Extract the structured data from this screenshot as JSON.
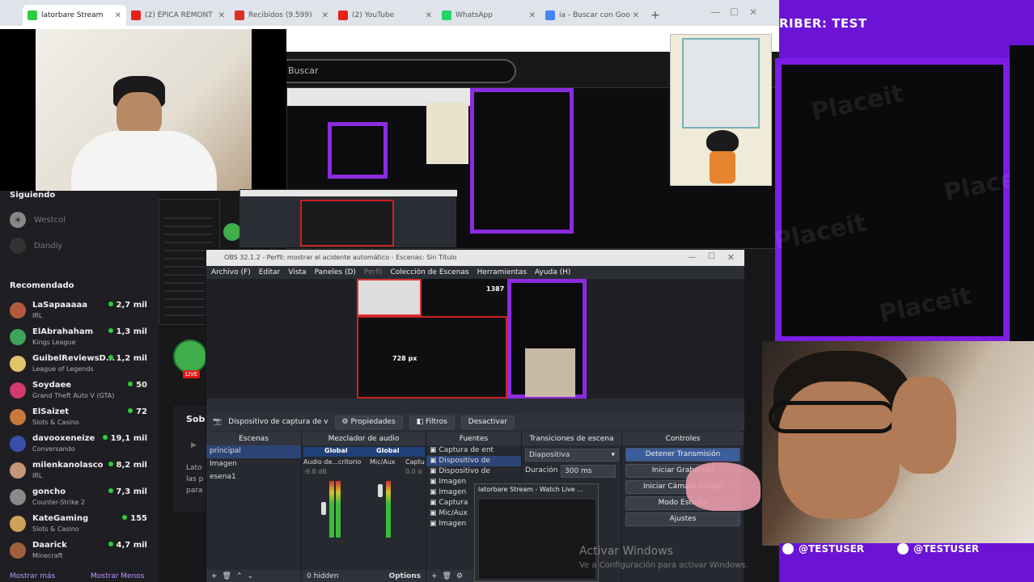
{
  "browser": {
    "tabs": [
      {
        "label": "latorbare Stream",
        "active": true,
        "color": "#2ecc40"
      },
      {
        "label": "(2) ÉPICA REMONT",
        "active": false,
        "color": "#e62117"
      },
      {
        "label": "Recibidos (9.599)",
        "active": false,
        "color": "#d93025"
      },
      {
        "label": "(2) YouTube",
        "active": false,
        "color": "#e62117"
      },
      {
        "label": "WhatsApp",
        "active": false,
        "color": "#25d366"
      },
      {
        "label": "ia - Buscar con Goo",
        "active": false,
        "color": "#4285f4"
      }
    ],
    "new_tab": "+"
  },
  "twitch": {
    "search_placeholder": "Buscar",
    "following_header": "Siguiendo",
    "following": [
      "Westcol",
      "Dandiy"
    ],
    "recommended_header": "Recomendado",
    "recommended": [
      {
        "name": "LaSapaaaaa",
        "game": "IRL",
        "viewers": "2,7 mil",
        "color": "#b45a3c"
      },
      {
        "name": "ElAbrahaham",
        "game": "Kings League",
        "viewers": "1,3 mil",
        "color": "#3fa35c"
      },
      {
        "name": "GuibelReviewsD...",
        "game": "League of Legends",
        "viewers": "1,2 mil",
        "color": "#e0c46a"
      },
      {
        "name": "Soydaee",
        "game": "Grand Theft Auto V (GTA)",
        "viewers": "50",
        "color": "#d23b6e"
      },
      {
        "name": "ElSaizet",
        "game": "Slots & Casino",
        "viewers": "72",
        "color": "#c87a3a"
      },
      {
        "name": "davooxeneize",
        "game": "Conversando",
        "viewers": "19,1 mil",
        "color": "#3a4fa8"
      },
      {
        "name": "milenkanolasco",
        "game": "IRL",
        "viewers": "8,2 mil",
        "color": "#c8957a"
      },
      {
        "name": "goncho",
        "game": "Counter-Strike 2",
        "viewers": "7,3 mil",
        "color": "#8a8a8a"
      },
      {
        "name": "KateGaming",
        "game": "Slots & Casino",
        "viewers": "155",
        "color": "#d0a15a"
      },
      {
        "name": "Daarick",
        "game": "Minecraft",
        "viewers": "4,7 mil",
        "color": "#a0603c"
      }
    ],
    "show_more": "Mostrar más",
    "show_less": "Mostrar Menos",
    "about_title": "Sob",
    "about_text": [
      "Lato",
      "las p",
      "para"
    ]
  },
  "overlay": {
    "title": "RIBER: TEST",
    "watermark": "Placeit",
    "users": [
      "@TESTUSER",
      "@TESTUSER"
    ]
  },
  "obs": {
    "title": "OBS 32.1.2 - Perfil: mostrar el acidente automático - Escenas: Sin Título",
    "menu": [
      "Archivo (F)",
      "Editar",
      "Vista",
      "Paneles (D)",
      "Perfil",
      "Colección de Escenas",
      "Herramientas",
      "Ayuda (H)"
    ],
    "preview_labels": {
      "top": "1387",
      "size": "728 px"
    },
    "source_name": "Dispositivo de captura de v",
    "buttons": {
      "properties": "Propiedades",
      "filters": "Filtros",
      "deactivate": "Desactivar"
    },
    "docks": {
      "scenes": {
        "title": "Escenas",
        "items": [
          "principal",
          "Imagen",
          "esena1"
        ]
      },
      "mixer": {
        "title": "Mezclador de audio",
        "ch1": "Global",
        "ch2": "Global",
        "ch1_label": "Audio de...critorio",
        "ch2_label": "Mic/Aux",
        "ch3_label": "Captu",
        "db": "-9.8 dB",
        "db2": "0.0 d",
        "footer": "0 hidden",
        "options": "Options"
      },
      "sources": {
        "title": "Fuentes",
        "items": [
          "Captura de ent",
          "Dispositivo de",
          "Dispositivo de",
          "Imagen",
          "Imagen",
          "Captura",
          "Mic/Aux",
          "Imagen"
        ]
      },
      "transitions": {
        "title": "Transiciones de escena",
        "type": "Diapositiva",
        "duration_label": "Duración",
        "duration": "300 ms"
      },
      "controls": {
        "title": "Controles",
        "items": [
          "Detener Transmisión",
          "Iniciar Grabación",
          "Iniciar Cámara Virtual",
          "Modo Estudio",
          "Ajustes"
        ]
      }
    },
    "popup_title": "latorbare Stream - Watch Live ..."
  },
  "windows_watermark": {
    "line1": "Activar Windows",
    "line2": "Ve a Configuración para activar Windows."
  }
}
